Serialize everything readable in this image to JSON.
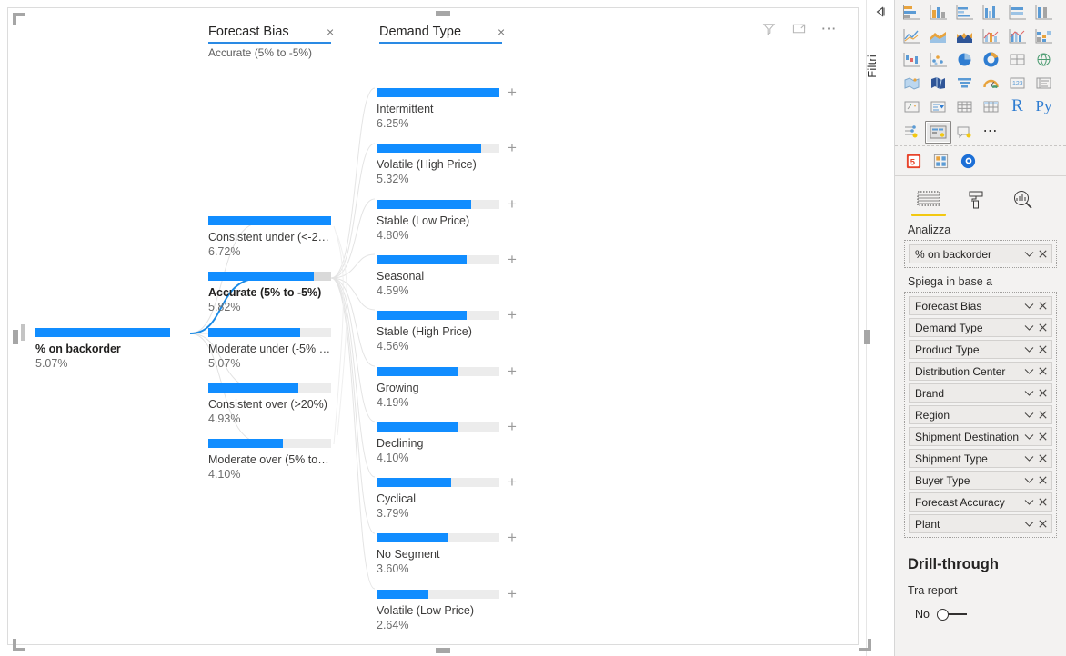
{
  "visual": {
    "header_icons": [
      {
        "name": "filter-icon",
        "glyph": "funnel"
      },
      {
        "name": "focus-mode-icon",
        "glyph": "focus"
      },
      {
        "name": "more-options-icon",
        "glyph": "..."
      }
    ]
  },
  "tree": {
    "root": {
      "label": "% on backorder",
      "value": "5.07%",
      "bar_pct": 100,
      "selected": true
    },
    "levels": [
      {
        "title": "Forecast Bias",
        "subtitle": "Accurate (5% to -5%)",
        "close_label": "×",
        "nodes": [
          {
            "label": "Consistent under (<-2…",
            "value": "6.72%",
            "bar_pct": 100,
            "selected": false,
            "expandable": false
          },
          {
            "label": "Accurate (5% to -5%)",
            "value": "5.82%",
            "bar_pct": 86,
            "selected": true,
            "expandable": false
          },
          {
            "label": "Moderate under (-5% …",
            "value": "5.07%",
            "bar_pct": 75,
            "selected": false,
            "expandable": false
          },
          {
            "label": "Consistent over (>20%)",
            "value": "4.93%",
            "bar_pct": 73,
            "selected": false,
            "expandable": false
          },
          {
            "label": "Moderate over (5% to …",
            "value": "4.10%",
            "bar_pct": 61,
            "selected": false,
            "expandable": false
          }
        ]
      },
      {
        "title": "Demand Type",
        "subtitle": "",
        "close_label": "×",
        "nodes": [
          {
            "label": "Intermittent",
            "value": "6.25%",
            "bar_pct": 100,
            "selected": false,
            "expandable": true
          },
          {
            "label": "Volatile (High Price)",
            "value": "5.32%",
            "bar_pct": 85,
            "selected": false,
            "expandable": true
          },
          {
            "label": "Stable (Low Price)",
            "value": "4.80%",
            "bar_pct": 77,
            "selected": false,
            "expandable": true
          },
          {
            "label": "Seasonal",
            "value": "4.59%",
            "bar_pct": 73,
            "selected": false,
            "expandable": true
          },
          {
            "label": "Stable (High Price)",
            "value": "4.56%",
            "bar_pct": 73,
            "selected": false,
            "expandable": true
          },
          {
            "label": "Growing",
            "value": "4.19%",
            "bar_pct": 67,
            "selected": false,
            "expandable": true
          },
          {
            "label": "Declining",
            "value": "4.10%",
            "bar_pct": 66,
            "selected": false,
            "expandable": true
          },
          {
            "label": "Cyclical",
            "value": "3.79%",
            "bar_pct": 61,
            "selected": false,
            "expandable": true
          },
          {
            "label": "No Segment",
            "value": "3.60%",
            "bar_pct": 58,
            "selected": false,
            "expandable": true
          },
          {
            "label": "Volatile (Low Price)",
            "value": "2.64%",
            "bar_pct": 42,
            "selected": false,
            "expandable": true
          }
        ]
      }
    ]
  },
  "filter_rail": {
    "label": "Filtri",
    "expand_icon": "expand-arrow-icon"
  },
  "right_panel": {
    "panel_tabs": [
      {
        "name": "filters-tab",
        "icon": "html5-icon"
      },
      {
        "name": "visualizations-tab",
        "icon": "visualizations-grid-icon"
      },
      {
        "name": "fields-tab",
        "icon": "fields-circle-icon"
      }
    ],
    "format_tabs": [
      {
        "name": "analyze-tab",
        "icon": "fields-table-icon",
        "active": true
      },
      {
        "name": "format-tab",
        "icon": "paint-roller-icon",
        "active": false
      },
      {
        "name": "analytics-tab",
        "icon": "magnifier-chart-icon",
        "active": false
      }
    ],
    "analyze_label": "Analizza",
    "analyze_field": {
      "label": "% on backorder"
    },
    "explain_by_label": "Spiega in base a",
    "explain_by_fields": [
      {
        "label": "Forecast Bias"
      },
      {
        "label": "Demand Type"
      },
      {
        "label": "Product Type"
      },
      {
        "label": "Distribution Center"
      },
      {
        "label": "Brand"
      },
      {
        "label": "Region"
      },
      {
        "label": "Shipment Destination"
      },
      {
        "label": "Shipment Type"
      },
      {
        "label": "Buyer Type"
      },
      {
        "label": "Forecast Accuracy"
      },
      {
        "label": "Plant"
      }
    ],
    "drillthrough": {
      "title": "Drill-through",
      "subtitle": "Tra report",
      "toggle_label": "No",
      "toggle_on": false
    }
  },
  "colors": {
    "bar_fill": "#118DFF",
    "bar_track": "#ECECEC",
    "bar_gray_tip": "#D9D9D9",
    "title_underline": "#2A8AE4",
    "accent_yellow": "#F2C811",
    "panel_bg": "#F3F2F1"
  }
}
